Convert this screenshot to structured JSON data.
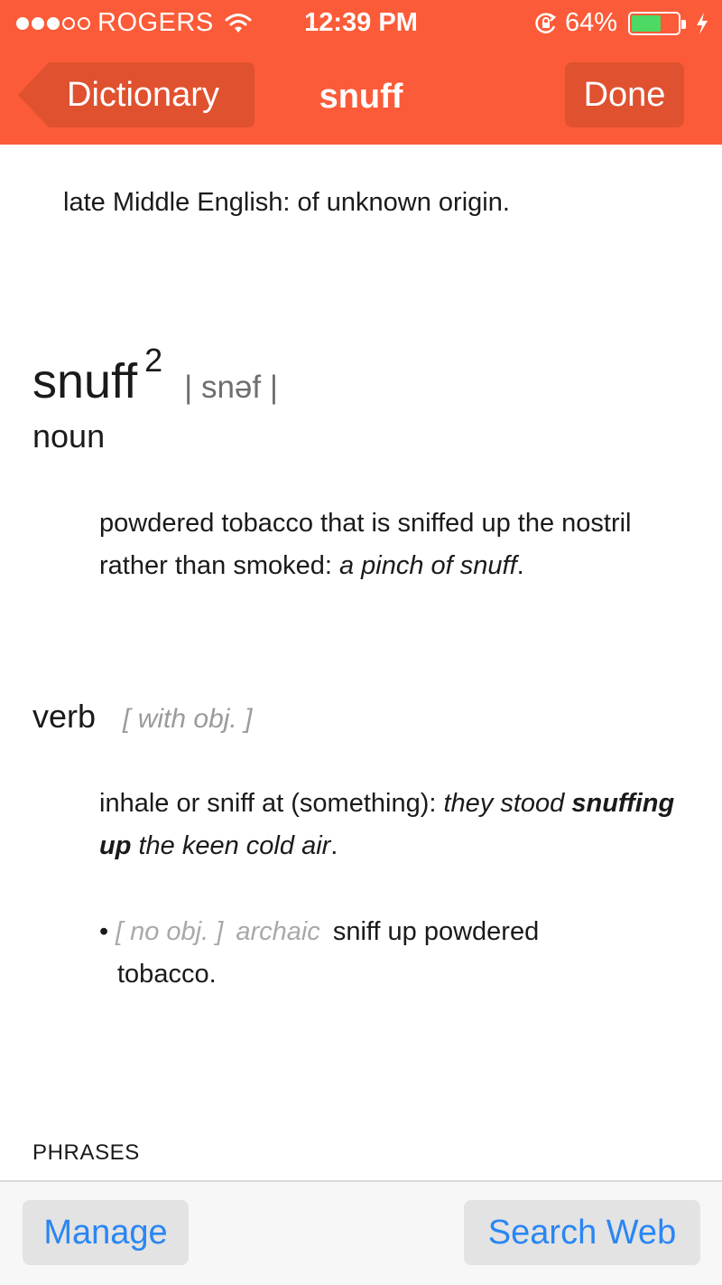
{
  "status_bar": {
    "carrier": "ROGERS",
    "time": "12:39 PM",
    "battery_percent": "64%",
    "battery_level": 0.64,
    "icons": [
      "signal-dots-icon",
      "wifi-icon",
      "rotation-lock-icon",
      "battery-icon",
      "charging-bolt-icon"
    ]
  },
  "nav": {
    "back_label": "Dictionary",
    "title": "snuff",
    "done_label": "Done"
  },
  "entry": {
    "origin": "late Middle English: of unknown origin.",
    "headword": "snuff",
    "homograph": "2",
    "pronunciation": "| snəf |",
    "noun": {
      "pos": "noun",
      "definition": "powdered tobacco that is sniffed up the nostril rather than smoked: ",
      "example": "a pinch of snuff",
      "end": "."
    },
    "verb": {
      "pos": "verb",
      "grammar": "[ with obj. ]",
      "definition": "inhale or sniff at (something): ",
      "example_start": "they stood ",
      "example_bold": "snuffing up",
      "example_end": " the keen cold air",
      "end": ".",
      "subsense": {
        "bullet": "•",
        "grammar": "[ no obj. ]",
        "register": "archaic",
        "line1": "sniff up powdered",
        "line2": "tobacco."
      }
    },
    "phrases_heading": "PHRASES"
  },
  "toolbar": {
    "manage_label": "Manage",
    "search_web_label": "Search Web"
  },
  "colors": {
    "nav_background": "#fb5b38",
    "button_tint": "#2a86f3",
    "battery_green": "#4cd964"
  }
}
